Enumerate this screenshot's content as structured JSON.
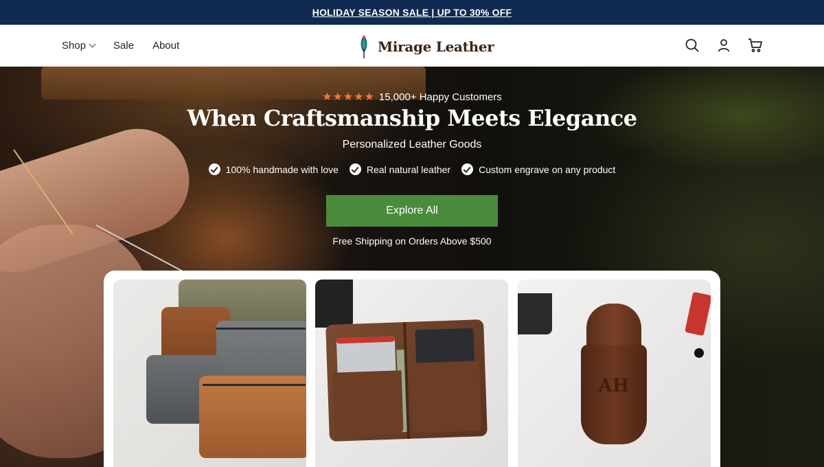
{
  "announcement": {
    "text": "HOLIDAY SEASON SALE | UP TO 30% OFF"
  },
  "nav": {
    "items": [
      {
        "label": "Shop",
        "has_dropdown": true
      },
      {
        "label": "Sale",
        "has_dropdown": false
      },
      {
        "label": "About",
        "has_dropdown": false
      }
    ]
  },
  "brand": {
    "name": "Mirage Leather",
    "logo_icon": "feather-logo-icon"
  },
  "header_icons": [
    "search-icon",
    "account-icon",
    "cart-icon"
  ],
  "hero": {
    "rating_stars": 5,
    "rating_text": "15,000+ Happy Customers",
    "headline": "When Craftsmanship Meets Elegance",
    "subheadline": "Personalized Leather Goods",
    "features": [
      "100% handmade with love",
      "Real natural leather",
      "Custom engrave on any product"
    ],
    "cta_label": "Explore All",
    "shipping_note": "Free Shipping on Orders Above $500"
  },
  "products": {
    "cards": [
      {
        "subject": "leather dopp kit bags"
      },
      {
        "subject": "leather card wallet"
      },
      {
        "subject": "leather cigar case",
        "engraving": "AH"
      }
    ]
  },
  "colors": {
    "announcement_bg": "#102a52",
    "cta_bg": "#4a8b3c",
    "star": "#f07a3a",
    "brand_text": "#3a2418"
  }
}
